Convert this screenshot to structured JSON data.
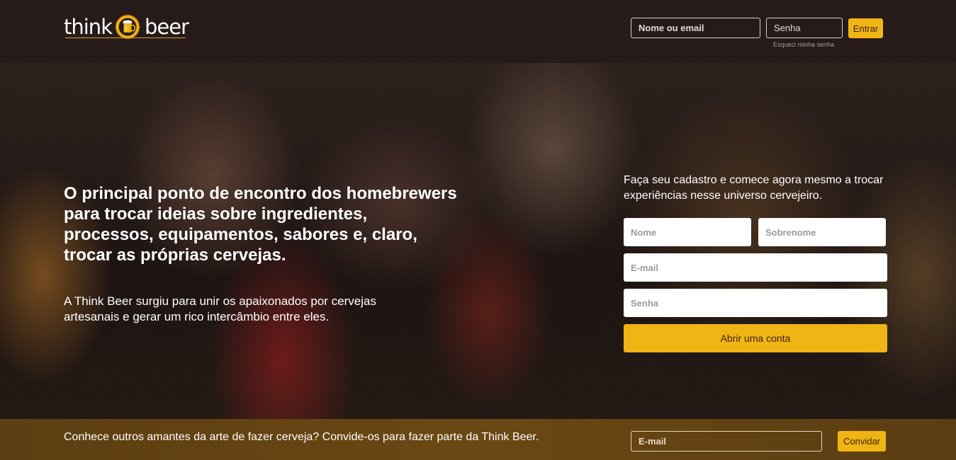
{
  "header": {
    "logo": {
      "word_left": "think",
      "word_right": "beer"
    },
    "login": {
      "user_placeholder": "Nome ou email",
      "password_placeholder": "Senha",
      "submit_label": "Entrar",
      "forgot_label": "Esqueci minha senha"
    }
  },
  "hero": {
    "headline": "O principal ponto de encontro dos homebrewers para trocar ideias sobre ingredientes, processos, equipamentos, sabores e, claro, trocar as próprias cervejas.",
    "subtext": "A Think Beer surgiu para unir os apaixonados por cervejas artesanais e gerar um rico intercâmbio entre eles."
  },
  "signup": {
    "title": "Faça seu cadastro e comece agora mesmo a trocar experiências nesse universo cervejeiro.",
    "first_name_placeholder": "Nome",
    "last_name_placeholder": "Sobrenome",
    "email_placeholder": "E-mail",
    "password_placeholder": "Senha",
    "submit_label": "Abrir uma conta"
  },
  "invite": {
    "text": "Conhece outros amantes da arte de fazer cerveja? Convide-os para fazer parte da Think Beer.",
    "email_placeholder": "E-mail",
    "button_label": "Convidar"
  },
  "colors": {
    "accent": "#f0b414",
    "header_bg": "#271b1a",
    "invite_bg": "#6b4813",
    "text_light": "#ffffff"
  },
  "icons": {
    "logo_badge": "beer-mug-icon"
  }
}
